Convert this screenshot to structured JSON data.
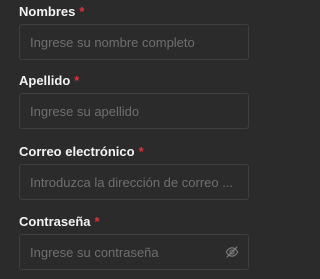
{
  "form": {
    "required_marker": "*",
    "fields": [
      {
        "label": "Nombres",
        "placeholder": "Ingrese su nombre completo",
        "value": ""
      },
      {
        "label": "Apellido",
        "placeholder": "Ingrese su apellido",
        "value": ""
      },
      {
        "label": "Correo electrónico",
        "placeholder": "Introduzca la dirección de correo ...",
        "value": ""
      },
      {
        "label": "Contraseña",
        "placeholder": "Ingrese su contraseña",
        "value": ""
      }
    ],
    "password_toggle_icon": "eye-slash-icon"
  },
  "colors": {
    "background": "#2b2b2b",
    "label": "#f2f2f2",
    "required": "#e0323a",
    "input_border": "#3f3f3f",
    "placeholder": "#6f6f6f"
  }
}
